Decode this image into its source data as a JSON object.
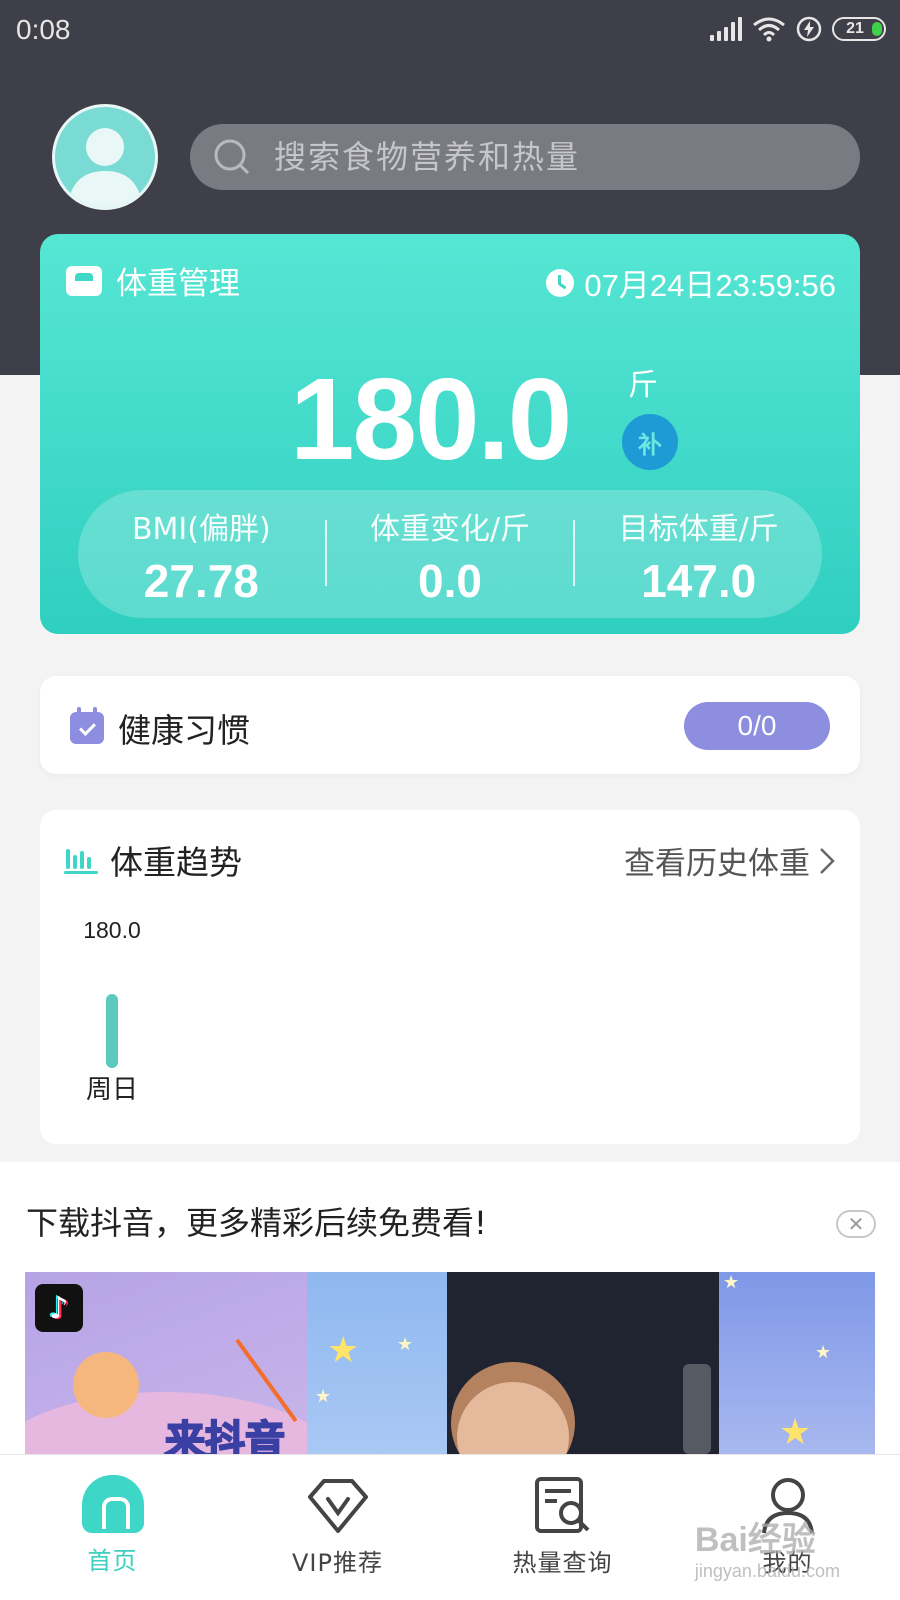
{
  "status_bar": {
    "time": "0:08",
    "battery": "21"
  },
  "search": {
    "placeholder": "搜索食物营养和热量"
  },
  "weight_card": {
    "title": "体重管理",
    "datetime": "07月24日23:59:56",
    "weight": "180.0",
    "unit": "斤",
    "supplement_label": "补",
    "stats": [
      {
        "label": "BMI(偏胖)",
        "value": "27.78"
      },
      {
        "label": "体重变化/斤",
        "value": "0.0"
      },
      {
        "label": "目标体重/斤",
        "value": "147.0"
      }
    ]
  },
  "habits": {
    "title": "健康习惯",
    "progress": "0/0"
  },
  "trend": {
    "title": "体重趋势",
    "history_link": "查看历史体重",
    "chart_data": {
      "type": "bar",
      "categories": [
        "周日"
      ],
      "values": [
        180.0
      ],
      "value_labels": [
        "180.0"
      ],
      "color": "#5cc8be"
    }
  },
  "ad": {
    "title": "下载抖音，更多精彩后续免费看!",
    "close_label": "✕",
    "banner_text": "来抖音"
  },
  "nav": {
    "items": [
      {
        "label": "首页",
        "icon": "home-icon"
      },
      {
        "label": "VIP推荐",
        "icon": "vip-icon"
      },
      {
        "label": "热量查询",
        "icon": "calorie-search-icon"
      },
      {
        "label": "我的",
        "icon": "profile-icon"
      }
    ]
  },
  "watermark": {
    "text": "Bai经验",
    "sub": "jingyan.baidu.com"
  },
  "colors": {
    "accent": "#3ed6c7",
    "header_bg": "#3e3f48",
    "habit_purple": "#8d8ee0"
  }
}
